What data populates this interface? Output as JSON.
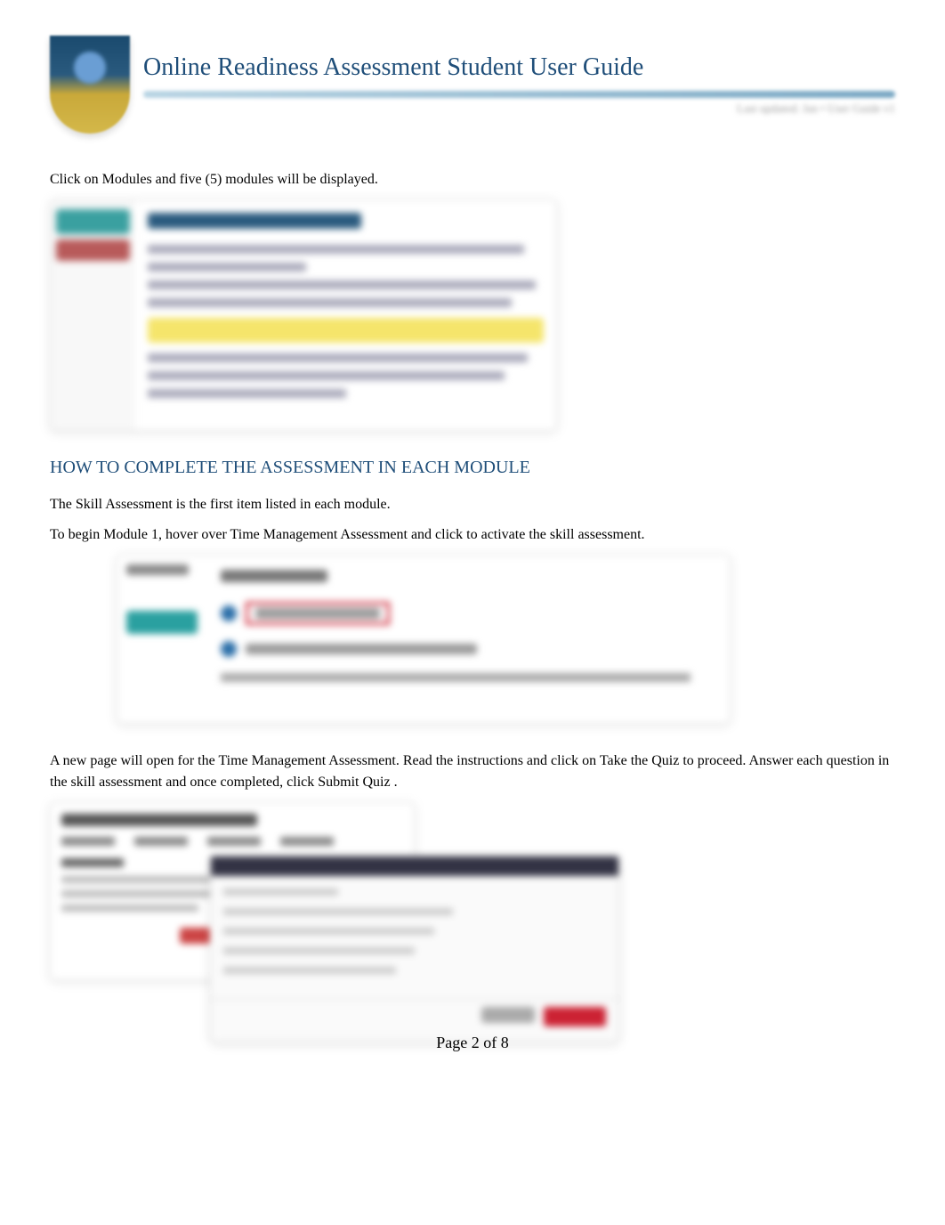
{
  "header": {
    "title": "Online Readiness Assessment Student User Guide",
    "meta": "Last updated: Jan • User Guide v1"
  },
  "para1": {
    "prefix": "Click on ",
    "button": "Modules",
    "suffix": " and five (5) modules will be displayed."
  },
  "section_heading": "HOW TO COMPLETE THE ASSESSMENT IN EACH MODULE",
  "para2": "The Skill Assessment is the first item listed in each module.",
  "para3": "To begin Module 1, hover over Time Management Assessment and click to activate the skill assessment.",
  "para4": {
    "prefix": "A new page will open for the Time Management Assessment. Read the instructions and click on ",
    "btn1": "Take the Quiz",
    "mid": " to proceed. Answer each question in the skill assessment and once completed, click ",
    "btn2": "Submit Quiz",
    "suffix": " ."
  },
  "pager": {
    "prefix": "Page ",
    "current": "2",
    "of": " of ",
    "total": "8"
  }
}
